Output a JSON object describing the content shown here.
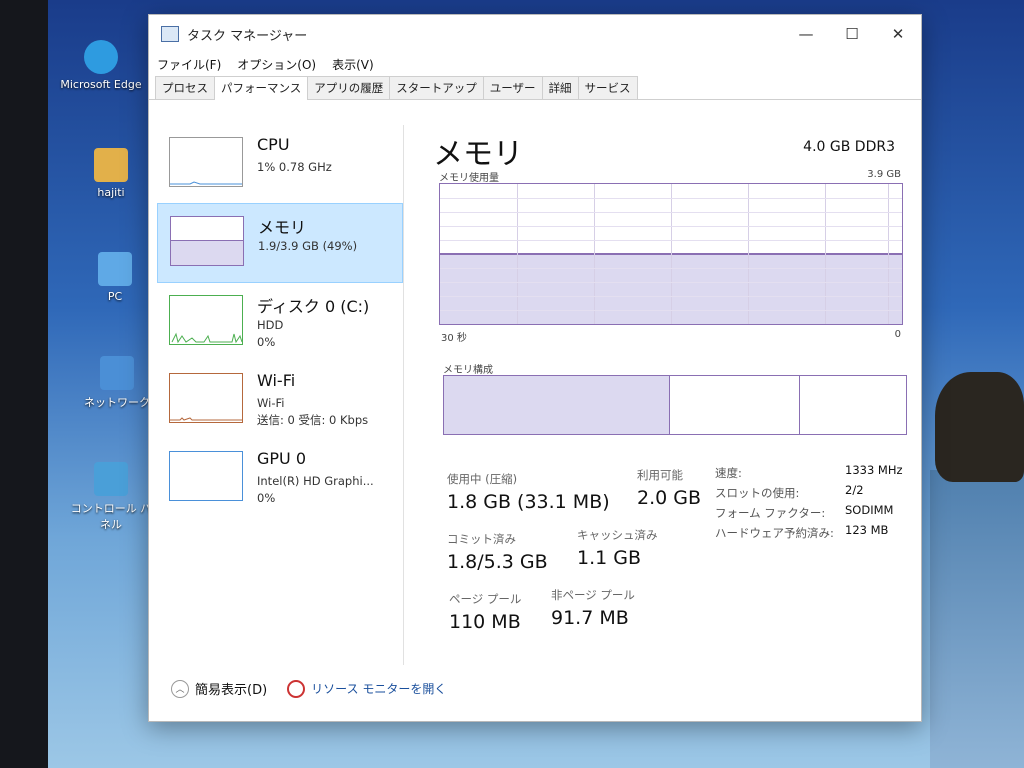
{
  "desktop": {
    "icons": [
      {
        "label": "Microsoft Edge",
        "icon": "edge-icon",
        "color": "#2e9be0"
      },
      {
        "label": "hajiti",
        "icon": "user-folder-icon",
        "color": "#e2b04a"
      },
      {
        "label": "PC",
        "icon": "pc-icon",
        "color": "#5fa9e6"
      },
      {
        "label": "ネットワーク",
        "icon": "network-icon",
        "color": "#4b8fd6"
      },
      {
        "label": "コントロール パネル",
        "icon": "control-panel-icon",
        "color": "#4a9fd8"
      }
    ]
  },
  "window": {
    "title": "タスク マネージャー",
    "controls": {
      "minimize": "—",
      "maximize": "☐",
      "close": "✕"
    },
    "menu": [
      "ファイル(F)",
      "オプション(O)",
      "表示(V)"
    ],
    "tabs": [
      "プロセス",
      "パフォーマンス",
      "アプリの履歴",
      "スタートアップ",
      "ユーザー",
      "詳細",
      "サービス"
    ],
    "active_tab": "パフォーマンス"
  },
  "resources": [
    {
      "name": "CPU",
      "sub1": "1%  0.78 GHz",
      "sub2": "",
      "color": "#4a90d9"
    },
    {
      "name": "メモリ",
      "sub1": "1.9/3.9 GB (49%)",
      "sub2": "",
      "color": "#8a6fb3"
    },
    {
      "name": "ディスク 0 (C:)",
      "sub1": "HDD",
      "sub2": "0%",
      "color": "#4caf50"
    },
    {
      "name": "Wi-Fi",
      "sub1": "Wi-Fi",
      "sub2": "送信: 0  受信: 0 Kbps",
      "color": "#b5683c"
    },
    {
      "name": "GPU 0",
      "sub1": "Intel(R) HD Graphi...",
      "sub2": "0%",
      "color": "#4a90d9"
    }
  ],
  "memory": {
    "title": "メモリ",
    "type": "4.0 GB DDR3",
    "usage_label": "メモリ使用量",
    "max_label": "3.9 GB",
    "x_left": "30 秒",
    "x_right": "0",
    "usage_fraction": 0.49,
    "composition_label": "メモリ構成",
    "composition_fractions": [
      0.49,
      0.28,
      0.23
    ],
    "stats": {
      "in_use_label": "使用中 (圧縮)",
      "in_use_value": "1.8 GB (33.1 MB)",
      "available_label": "利用可能",
      "available_value": "2.0 GB",
      "committed_label": "コミット済み",
      "committed_value": "1.8/5.3 GB",
      "cached_label": "キャッシュ済み",
      "cached_value": "1.1 GB",
      "paged_label": "ページ プール",
      "paged_value": "110 MB",
      "nonpaged_label": "非ページ プール",
      "nonpaged_value": "91.7 MB"
    },
    "details": {
      "speed_key": "速度:",
      "speed_val": "1333 MHz",
      "slots_key": "スロットの使用:",
      "slots_val": "2/2",
      "form_key": "フォーム ファクター:",
      "form_val": "SODIMM",
      "reserved_key": "ハードウェア予約済み:",
      "reserved_val": "123 MB"
    }
  },
  "footer": {
    "fewer_details": "簡易表示(D)",
    "resource_monitor": "リソース モニターを開く"
  }
}
